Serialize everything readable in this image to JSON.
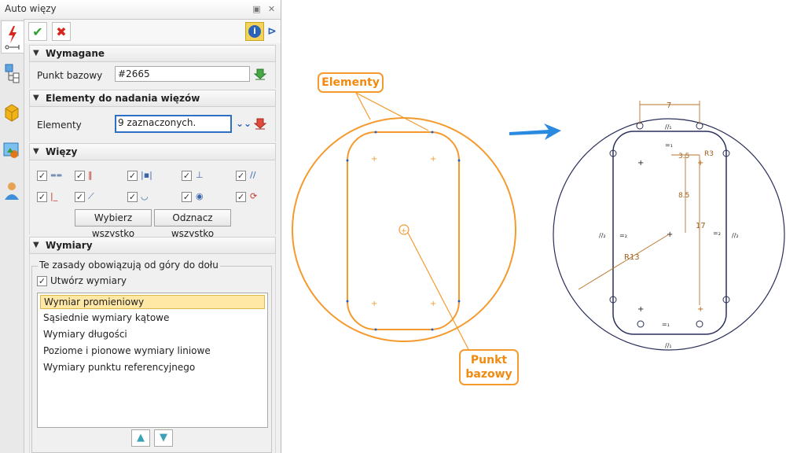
{
  "window": {
    "title": "Auto więzy"
  },
  "toolbar": {
    "ok": "✔",
    "cancel": "✖",
    "info": "i"
  },
  "required": {
    "header": "Wymagane",
    "base_point_label": "Punkt bazowy",
    "base_point_value": "#2665"
  },
  "entities": {
    "header": "Elementy do nadania więzów",
    "label": "Elementy",
    "value": "9 zaznaczonych."
  },
  "constraints": {
    "header": "Więzy",
    "select_all": "Wybierz wszystko",
    "deselect_all": "Odznacz wszystko"
  },
  "dimensions": {
    "header": "Wymiary",
    "group_label": "Te zasady obowiązują od góry do dołu",
    "create_label": "Utwórz wymiary",
    "rules": [
      "Wymiar promieniowy",
      "Sąsiednie wymiary kątowe",
      "Wymiary długości",
      "Poziome i pionowe wymiary liniowe",
      "Wymiary punktu referencyjnego"
    ]
  },
  "callouts": {
    "elements": "Elementy",
    "base_point_line1": "Punkt",
    "base_point_line2": "bazowy"
  },
  "result": {
    "dim_top": "7",
    "dim_35": "3.5",
    "dim_r3": "R3",
    "dim_85": "8.5",
    "dim_17": "17",
    "dim_r13": "R13",
    "eq1": "=₁",
    "par1": "//₁",
    "par2": "//₂",
    "eq2": "=₂"
  },
  "colors": {
    "accent": "#f59a2d",
    "sketch": "#2a2f5a",
    "arrow": "#2a8ae0"
  }
}
